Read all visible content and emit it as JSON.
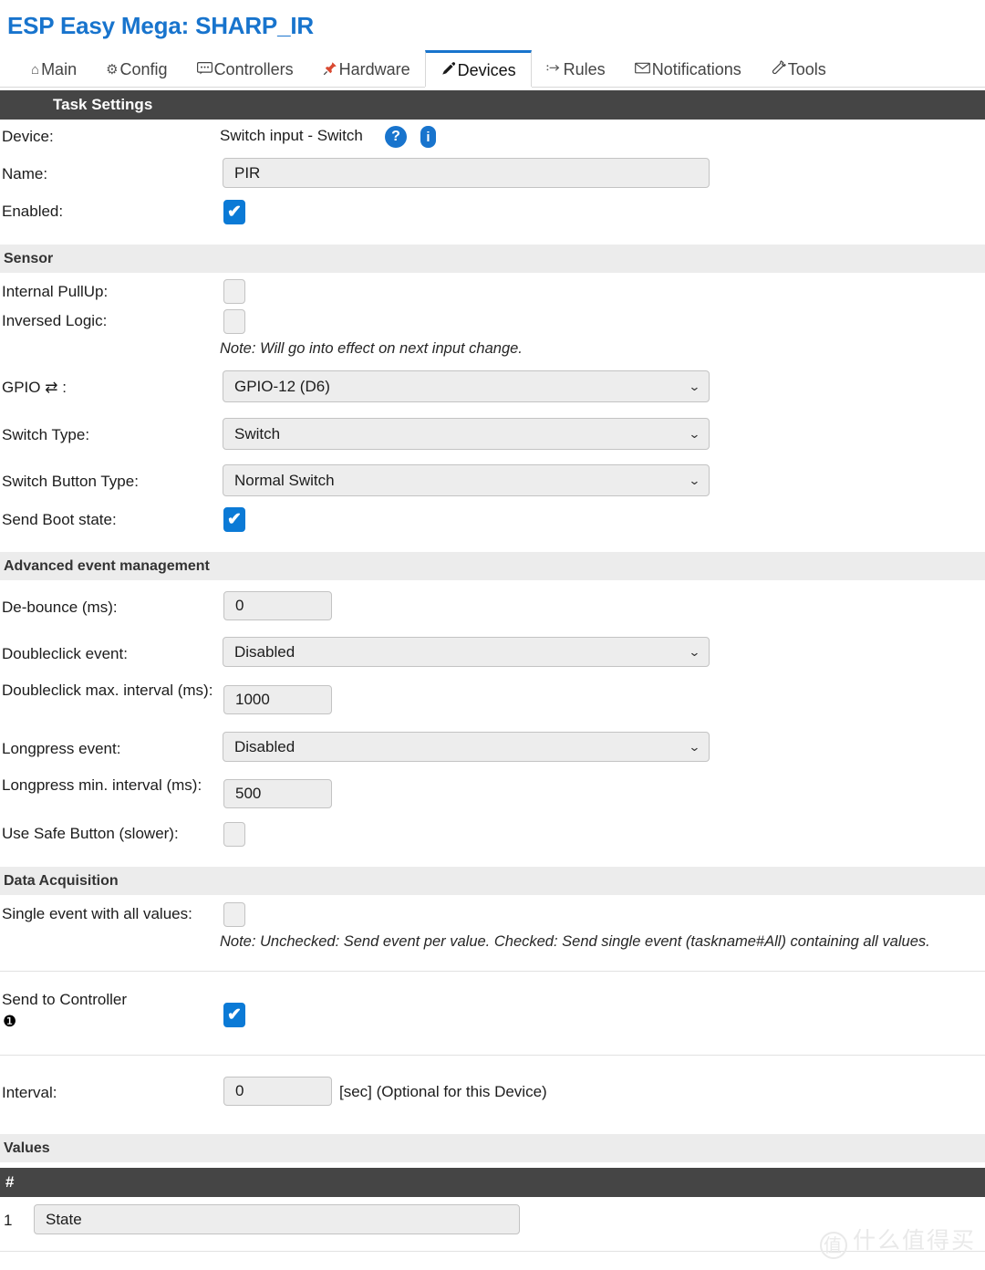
{
  "header": {
    "title": "ESP Easy Mega: SHARP_IR",
    "title_color": "#1874cd"
  },
  "tabs": [
    {
      "label": "Main",
      "icon": "home-icon",
      "glyph": "⌂",
      "active": false
    },
    {
      "label": "Config",
      "icon": "gear-icon",
      "glyph": "⚙",
      "active": false
    },
    {
      "label": "Controllers",
      "icon": "chat-icon",
      "glyph": "💬",
      "active": false
    },
    {
      "label": "Hardware",
      "icon": "pushpin-icon",
      "glyph": "📌",
      "active": false
    },
    {
      "label": "Devices",
      "icon": "plug-icon",
      "glyph": "🔌",
      "active": true
    },
    {
      "label": "Rules",
      "icon": "arrow-right-icon",
      "glyph": "⇢",
      "active": false
    },
    {
      "label": "Notifications",
      "icon": "envelope-icon",
      "glyph": "✉",
      "active": false
    },
    {
      "label": "Tools",
      "icon": "wrench-icon",
      "glyph": "🔧",
      "active": false
    }
  ],
  "task_settings": {
    "bar_label": "Task Settings",
    "device_label": "Device:",
    "device_value": "Switch input - Switch",
    "help_badge": "?",
    "info_badge": "i",
    "name_label": "Name:",
    "name_value": "PIR",
    "enabled_label": "Enabled:",
    "enabled_checked": true
  },
  "sensor": {
    "bar_label": "Sensor",
    "internal_pullup_label": "Internal PullUp:",
    "internal_pullup_checked": false,
    "inversed_logic_label": "Inversed Logic:",
    "inversed_logic_checked": false,
    "note": "Note: Will go into effect on next input change.",
    "gpio_label": "GPIO ⇄ :",
    "gpio_value": "GPIO-12 (D6)",
    "switch_type_label": "Switch Type:",
    "switch_type_value": "Switch",
    "switch_button_type_label": "Switch Button Type:",
    "switch_button_type_value": "Normal Switch",
    "send_boot_state_label": "Send Boot state:",
    "send_boot_state_checked": true
  },
  "advanced": {
    "bar_label": "Advanced event management",
    "debounce_label": "De-bounce (ms):",
    "debounce_value": "0",
    "doubleclick_event_label": "Doubleclick event:",
    "doubleclick_event_value": "Disabled",
    "doubleclick_interval_label": "Doubleclick max. interval (ms):",
    "doubleclick_interval_value": "1000",
    "longpress_event_label": "Longpress event:",
    "longpress_event_value": "Disabled",
    "longpress_interval_label": "Longpress min. interval (ms):",
    "longpress_interval_value": "500",
    "safe_button_label": "Use Safe Button (slower):",
    "safe_button_checked": false
  },
  "data_acquisition": {
    "bar_label": "Data Acquisition",
    "single_event_label": "Single event with all values:",
    "single_event_checked": false,
    "note": "Note: Unchecked: Send event per value. Checked: Send single event (taskname#All) containing all values.",
    "send_to_controller_label": "Send to Controller",
    "send_to_controller_number": "❶",
    "send_to_controller_checked": true,
    "interval_label": "Interval:",
    "interval_value": "0",
    "interval_suffix": "[sec] (Optional for this Device)"
  },
  "values": {
    "bar_label": "Values",
    "column_header": "#",
    "rows": [
      {
        "index": "1",
        "name": "State"
      }
    ]
  },
  "watermark": {
    "circle": "值",
    "text": "什么值得买"
  },
  "colors": {
    "accent": "#1874cd",
    "checkbox_on": "#0b7ad6",
    "dark_bar": "#454545",
    "grey_bar": "#ececec",
    "field_bg": "#ededed"
  }
}
